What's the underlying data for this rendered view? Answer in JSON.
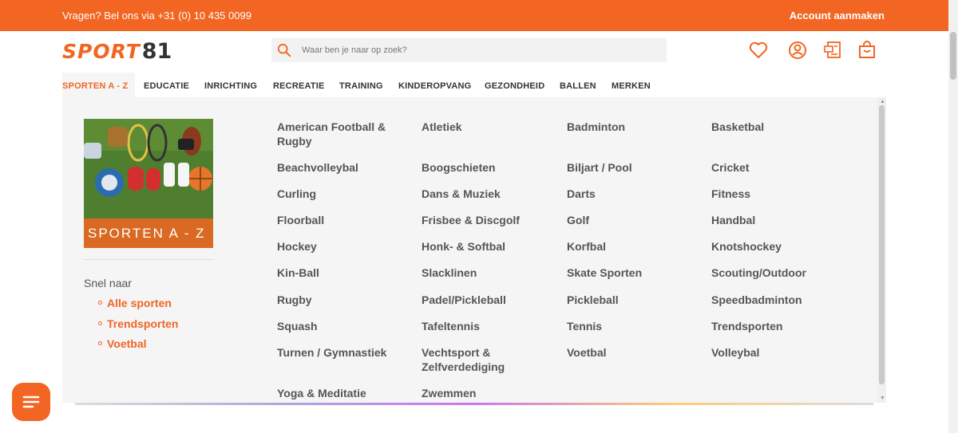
{
  "topbar": {
    "phone": "Vragen? Bel ons via +31 (0) 10 435 0099",
    "account": "Account aanmaken"
  },
  "logo": {
    "word": "SPORT",
    "number": "81"
  },
  "search": {
    "placeholder": "Waar ben je naar op zoek?"
  },
  "colors": {
    "brand": "#f26522",
    "text": "#555555",
    "panel": "#f5f5f5"
  },
  "header_icons": [
    "heart-icon",
    "user-icon",
    "quote-icon",
    "cart-icon"
  ],
  "nav": [
    "SPORTEN A - Z",
    "EDUCATIE",
    "INRICHTING",
    "RECREATIE",
    "TRAINING",
    "KINDEROPVANG",
    "GEZONDHEID",
    "BALLEN",
    "MERKEN"
  ],
  "promo": {
    "label": "SPORTEN A - Z"
  },
  "quick": {
    "title": "Snel naar",
    "links": [
      "Alle sporten",
      "Trendsporten",
      "Voetbal"
    ]
  },
  "sports": [
    "American Football & Rugby",
    "Atletiek",
    "Badminton",
    "Basketbal",
    "Beachvolleybal",
    "Boogschieten",
    "Biljart / Pool",
    "Cricket",
    "Curling",
    "Dans & Muziek",
    "Darts",
    "Fitness",
    "Floorball",
    "Frisbee & Discgolf",
    "Golf",
    "Handbal",
    "Hockey",
    "Honk- & Softbal",
    "Korfbal",
    "Knotshockey",
    "Kin-Ball",
    "Slacklinen",
    "Skate Sporten",
    "Scouting/Outdoor",
    "Rugby",
    "Padel/Pickleball",
    "Pickleball",
    "Speedbadminton",
    "Squash",
    "Tafeltennis",
    "Tennis",
    "Trendsporten",
    "Turnen / Gymnastiek",
    "Vechtsport & Zelfverdediging",
    "Voetbal",
    "Volleybal",
    "Yoga & Meditatie",
    "Zwemmen"
  ]
}
